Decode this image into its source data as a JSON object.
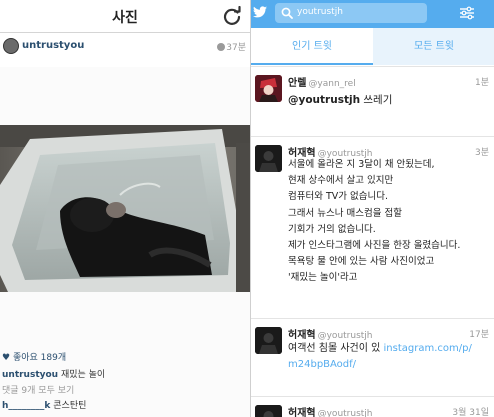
{
  "instagram": {
    "title": "사진",
    "username": "untrustyou",
    "time": "37분",
    "likes_icon": "♥",
    "likes": "좋아요 189개",
    "caption": {
      "user": "untrustyou",
      "text": " 재밌는 놀이"
    },
    "comments_all": "댓글 9개 모두 보기",
    "comment": {
      "user": "h________k",
      "text": " 콘스탄틴"
    },
    "icons": {
      "refresh": "refresh-icon",
      "clock": "clock-icon"
    }
  },
  "twitter": {
    "search_text": "youtrustjh",
    "tabs": {
      "top": "인기 트윗",
      "all": "모든 트윗"
    },
    "colors": {
      "brand": "#55acee",
      "link": "#55acee"
    },
    "icons": {
      "bird": "twitter-bird-icon",
      "search": "search-icon",
      "filter": "filter-icon"
    },
    "tweets": [
      {
        "name": "안렐",
        "handle": "@yann_rel",
        "time": "1분",
        "mention": "@youtrustjh",
        "lines": [
          " 쓰레기"
        ]
      },
      {
        "name": "허재혁",
        "handle": "@youtrustjh",
        "time": "3분",
        "lines": [
          "서울에 올라온 지 3달이 채 안됬는데,",
          "현재 상수에서 살고 있지만",
          "컴퓨터와 TV가 없습니다.",
          "그래서 뉴스나 매스컴을 접할",
          "기회가 거의 없습니다.",
          "제가 인스타그램에 사진을 한장 올렸습니다.",
          "목욕탕 물 안에 있는 사람 사진이었고",
          "'재밌는 놀이'라고"
        ]
      },
      {
        "name": "허재혁",
        "handle": "@youtrustjh",
        "time": "17분",
        "line1": "여객선 침몰 사건이 있 ",
        "link1": "instagram.com/p/",
        "link2": "m24bpBAodf/"
      },
      {
        "name": "허재혁",
        "handle": "@youtrustjh",
        "time": "3월 31일"
      }
    ]
  }
}
